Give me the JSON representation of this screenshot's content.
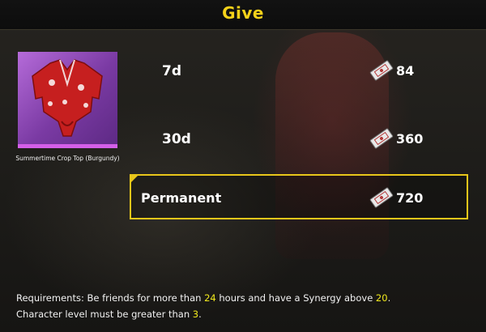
{
  "header": {
    "title": "Give"
  },
  "item": {
    "name": "Summertime Crop Top (Burgundy)",
    "rarity_color": "#d45fe8"
  },
  "options": [
    {
      "label": "7d",
      "price": "84",
      "selected": false
    },
    {
      "label": "30d",
      "price": "360",
      "selected": false
    },
    {
      "label": "Permanent",
      "price": "720",
      "selected": true
    }
  ],
  "currency_icon": "coupon-icon",
  "requirements": {
    "line1_a": "Requirements: Be friends for more than ",
    "hours": "24",
    "line1_b": " hours and have a Synergy above ",
    "synergy": "20",
    "line1_c": ".",
    "line2_a": " Character level must be greater than ",
    "level": "3",
    "line2_b": "."
  },
  "colors": {
    "accent_yellow": "#f5d21a",
    "highlight_yellow": "#f0e81c"
  }
}
